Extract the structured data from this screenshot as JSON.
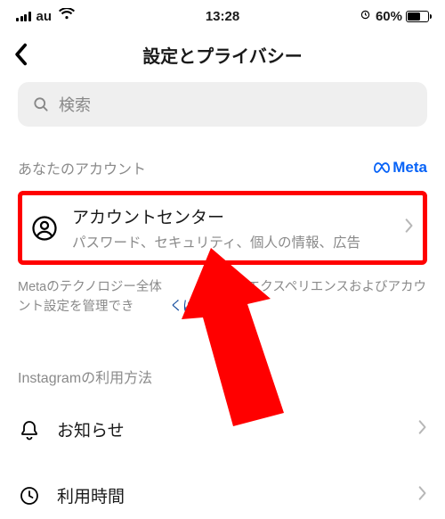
{
  "status": {
    "carrier": "au",
    "time": "13:28",
    "battery_text": "60%"
  },
  "header": {
    "title": "設定とプライバシー"
  },
  "search": {
    "placeholder": "検索"
  },
  "your_account": {
    "heading": "あなたのアカウント",
    "meta": "Meta"
  },
  "account_center": {
    "title": "アカウントセンター",
    "subtitle": "パスワード、セキュリティ、個人の情報、広告"
  },
  "meta_desc": {
    "prefix": "Metaのテクノロジー全体",
    "mid": "テッドエクスペリエンスおよびアカウント設定を管理でき",
    "suffix": "くはこちら"
  },
  "instagram_section": {
    "heading": "Instagramの利用方法",
    "items": [
      {
        "label": "お知らせ"
      },
      {
        "label": "利用時間"
      }
    ]
  }
}
